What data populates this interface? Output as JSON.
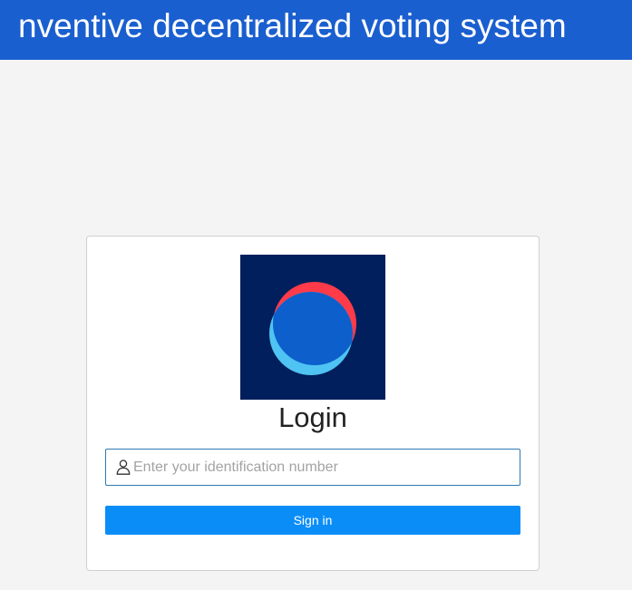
{
  "header": {
    "title": "nventive decentralized voting system",
    "background_color": "#1a5fcf",
    "text_color": "#ffffff"
  },
  "page": {
    "background_color": "#f4f4f4"
  },
  "login_card": {
    "logo": {
      "icon": "overlapping-circles-logo",
      "background_color": "#001f5c",
      "colors": [
        "#ff3b4a",
        "#4fc3f2",
        "#0d5fcb"
      ]
    },
    "heading": "Login",
    "identification_field": {
      "icon": "user-icon",
      "value": "",
      "placeholder": "Enter your identification number",
      "border_color": "#2f7ab3"
    },
    "signin_button": {
      "label": "Sign in",
      "background_color": "#0b8df8"
    }
  }
}
